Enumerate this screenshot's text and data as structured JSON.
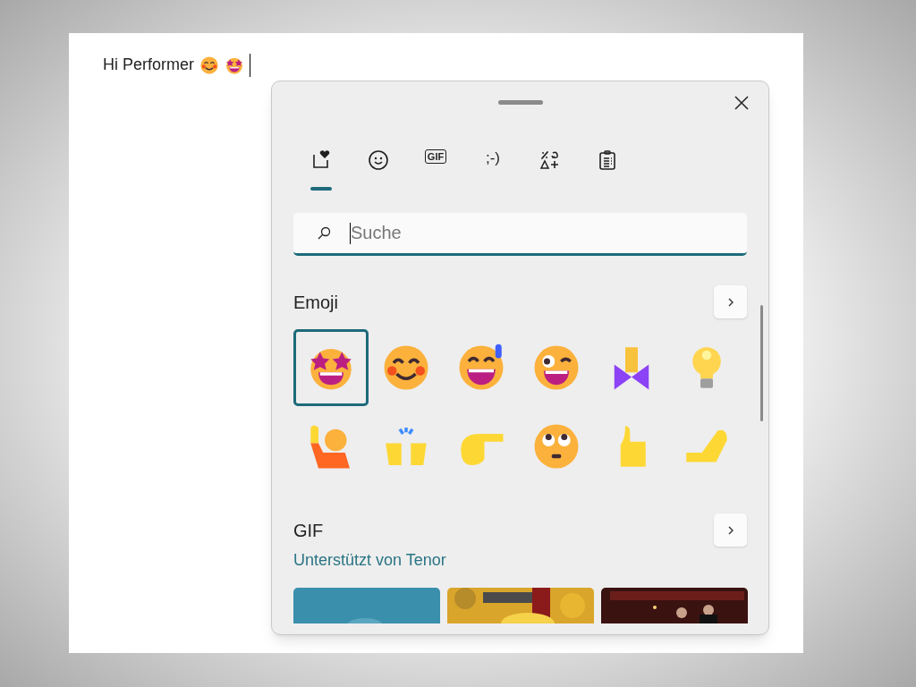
{
  "document": {
    "text": "Hi Performer",
    "inline_emoji": [
      {
        "kind": "smiling"
      },
      {
        "kind": "star-struck"
      }
    ]
  },
  "tabs": [
    {
      "kind": "favorites",
      "selected": true
    },
    {
      "kind": "emoji",
      "selected": false
    },
    {
      "kind": "gif",
      "label": "GIF",
      "selected": false
    },
    {
      "kind": "kaomoji",
      "label": ";-)",
      "selected": false
    },
    {
      "kind": "symbols",
      "selected": false
    },
    {
      "kind": "clipboard",
      "selected": false
    }
  ],
  "search": {
    "placeholder": "Suche"
  },
  "emoji_section": {
    "title": "Emoji",
    "items": [
      {
        "kind": "star-struck",
        "selected": true
      },
      {
        "kind": "smiling",
        "selected": false
      },
      {
        "kind": "sweat-grin",
        "selected": false
      },
      {
        "kind": "zany",
        "selected": false
      },
      {
        "kind": "praying",
        "selected": false
      },
      {
        "kind": "bulb",
        "selected": false
      },
      {
        "kind": "raising-hand",
        "selected": false
      },
      {
        "kind": "raising-hands",
        "selected": false
      },
      {
        "kind": "pointing",
        "selected": false
      },
      {
        "kind": "eye-roll",
        "selected": false
      },
      {
        "kind": "thumbs-up",
        "selected": false
      },
      {
        "kind": "pinching",
        "selected": false
      }
    ]
  },
  "gif_section": {
    "title": "GIF",
    "credit": "Unterstützt von Tenor"
  }
}
